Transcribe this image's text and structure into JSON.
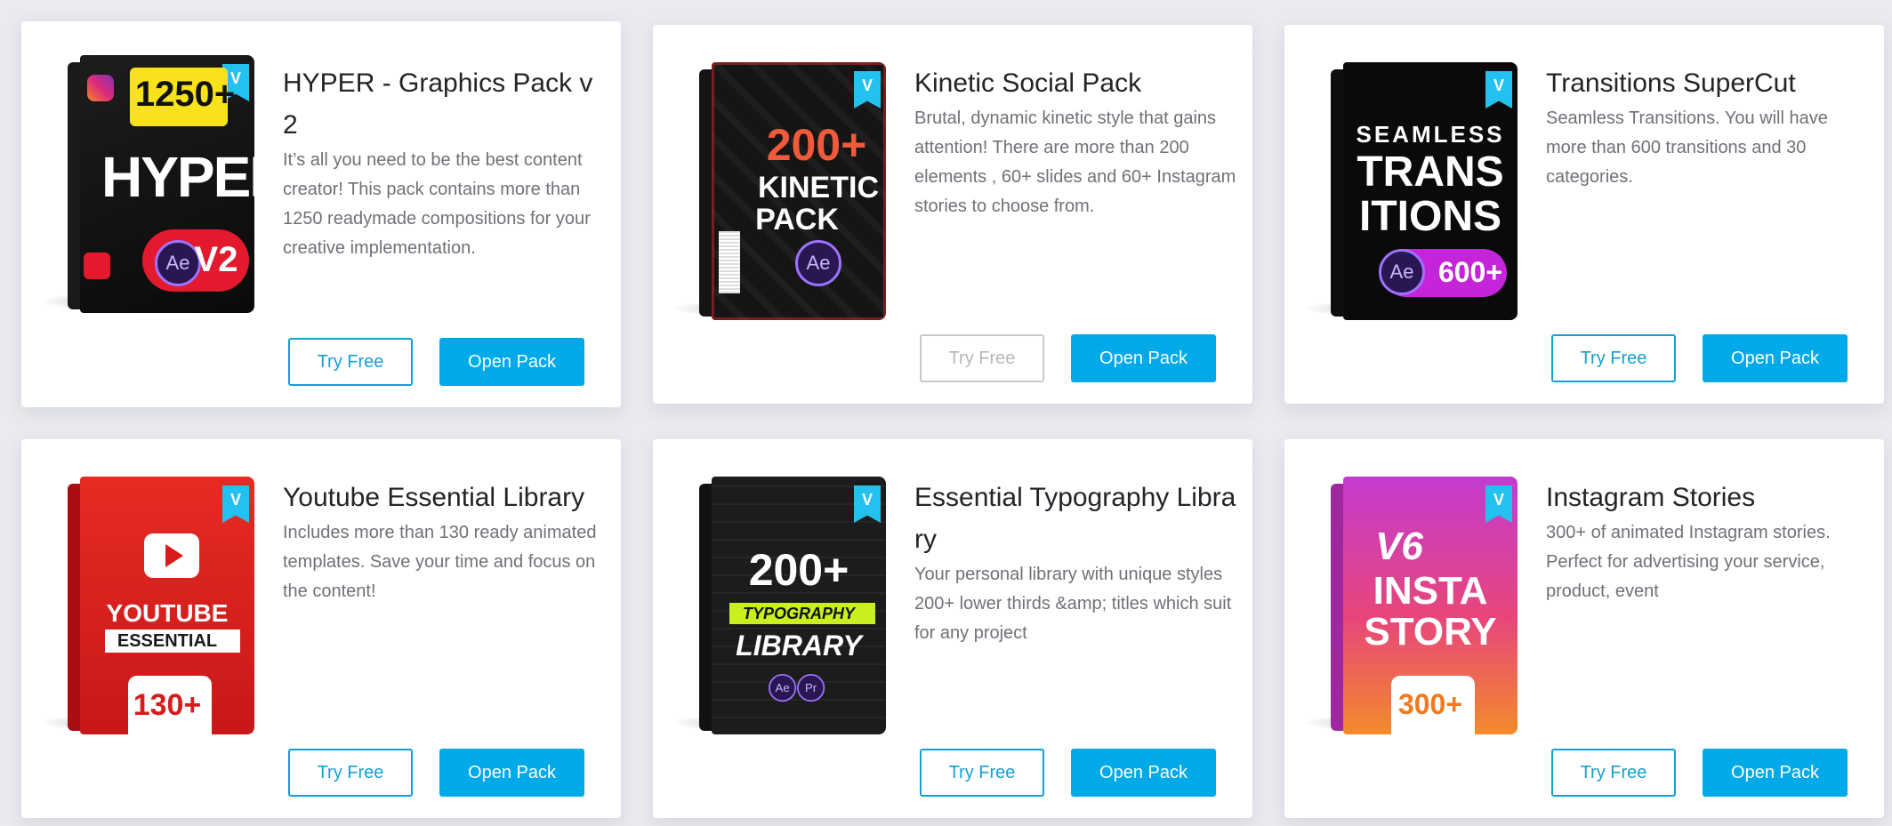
{
  "packs": [
    {
      "title": "HYPER - Graphics Pack v 2",
      "description": "It’s all you need to be the best content creator! This pack contains more than 1250 readymade compositions for your creative implementation.",
      "try_label": "Try Free",
      "open_label": "Open Pack",
      "box": {
        "line1": "1250+",
        "line2": "HYPER",
        "badge": "V2",
        "ae": "Ae"
      }
    },
    {
      "title": "Kinetic Social Pack",
      "description": "Brutal, dynamic kinetic style that gains attention! There are more than 200 elements , 60+ slides and 60+ Instagram stories to choose from.",
      "try_label": "Try Free",
      "open_label": "Open Pack",
      "box": {
        "line1": "200+",
        "line2": "KINETIC",
        "line3": "PACK",
        "ae": "Ae"
      }
    },
    {
      "title": "Transitions SuperCut",
      "description": "Seamless Transitions. You will have more than 600 transitions and 30 categories.",
      "try_label": "Try Free",
      "open_label": "Open Pack",
      "box": {
        "line1": "SEAMLESS",
        "line2": "TRANS",
        "line3": "ITIONS",
        "badge": "600+",
        "ae": "Ae"
      }
    },
    {
      "title": "Youtube Essential Library",
      "description": "Includes more than 130 ready animated templates. Save your time and focus on the content!",
      "try_label": "Try Free",
      "open_label": "Open Pack",
      "box": {
        "line1": "YOUTUBE",
        "line2": "ESSENTIAL",
        "badge": "130+"
      }
    },
    {
      "title": "Essential Typography Library",
      "description": "Your personal library with unique styles 200+ lower thirds &amp; titles which suit for any project",
      "try_label": "Try Free",
      "open_label": "Open Pack",
      "box": {
        "line1": "200+",
        "line2": "TYPOGRAPHY",
        "line3": "LIBRARY",
        "ae": "Ae",
        "pr": "Pr"
      }
    },
    {
      "title": "Instagram Stories",
      "description": "300+ of animated Instagram stories. Perfect for advertising your service, product, event",
      "try_label": "Try Free",
      "open_label": "Open Pack",
      "box": {
        "line1": "V6",
        "line2": "INSTA",
        "line3": "STORY",
        "badge": "300+"
      }
    }
  ],
  "colors": {
    "accent": "#00a9e8",
    "outline": "#149fd4",
    "disabled": "#c7c9cc",
    "title": "#222428",
    "text": "#6e7178",
    "page_bg": "#eaebf0"
  }
}
